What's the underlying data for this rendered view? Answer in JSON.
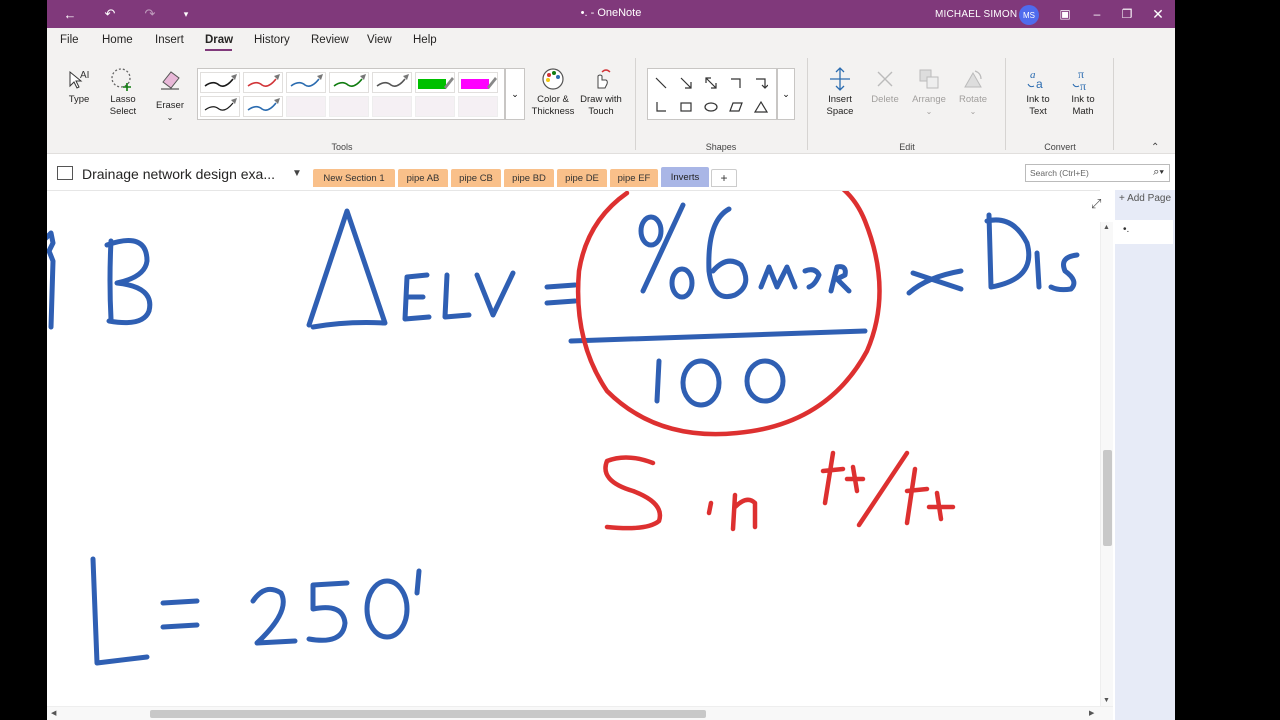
{
  "titlebar": {
    "title": "•. - OneNote",
    "user": "MICHAEL SIMON",
    "initials": "MS"
  },
  "menu": {
    "items": [
      "File",
      "Home",
      "Insert",
      "Draw",
      "History",
      "Review",
      "View",
      "Help"
    ],
    "active": "Draw"
  },
  "ribbon": {
    "type": "Type",
    "lasso": [
      "Lasso",
      "Select"
    ],
    "eraser": "Eraser",
    "color_thickness": [
      "Color &",
      "Thickness"
    ],
    "draw_touch": [
      "Draw with",
      "Touch"
    ],
    "insert_space": [
      "Insert",
      "Space"
    ],
    "delete": "Delete",
    "arrange": "Arrange",
    "rotate": "Rotate",
    "ink_text": [
      "Ink to",
      "Text"
    ],
    "ink_math": [
      "Ink to",
      "Math"
    ],
    "groups": {
      "tools": "Tools",
      "shapes": "Shapes",
      "edit": "Edit",
      "convert": "Convert"
    },
    "pens": [
      {
        "color": "#1a1a1a"
      },
      {
        "color": "#d13438"
      },
      {
        "color": "#2b6cb0"
      },
      {
        "color": "#107c10"
      },
      {
        "color": "#555555"
      },
      {
        "color": "#00c000",
        "highlighter": true
      },
      {
        "color": "#ff00ff",
        "highlighter": true
      },
      {
        "color": "#1a1a1a"
      },
      {
        "color": "#2b6cb0"
      }
    ]
  },
  "notebook": {
    "title": "Drainage network design exa...",
    "tabs": [
      "New Section 1",
      "pipe AB",
      "pipe CB",
      "pipe BD",
      "pipe DE",
      "pipe EF",
      "Inverts"
    ],
    "active_tab": "Inverts",
    "search_placeholder": "Search (Ctrl+E)"
  },
  "pages": {
    "add_label": "Add Page",
    "current": "•."
  },
  "colors": {
    "accent": "#80397b",
    "ink_blue": "#2f5fb3",
    "ink_red": "#dd3030"
  }
}
